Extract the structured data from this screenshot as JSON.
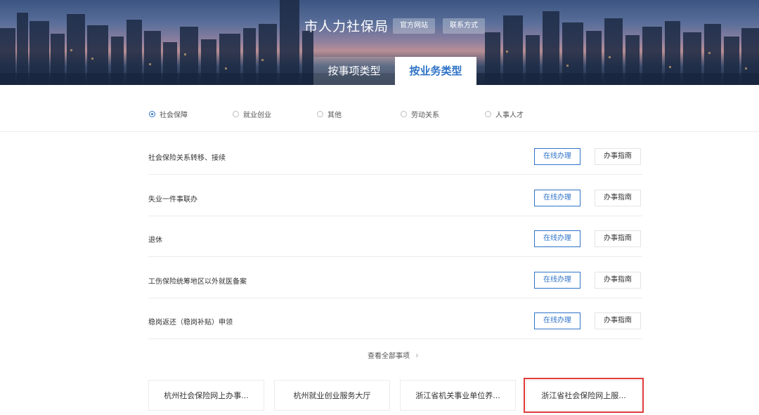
{
  "header": {
    "title": "市人力社保局",
    "links": {
      "official_site": "官方网站",
      "contact": "联系方式"
    },
    "tabs": [
      {
        "label": "按事项类型",
        "active": false
      },
      {
        "label": "按业务类型",
        "active": true
      }
    ]
  },
  "filters": {
    "options": [
      {
        "label": "社会保障",
        "checked": true
      },
      {
        "label": "就业创业",
        "checked": false
      },
      {
        "label": "其他",
        "checked": false
      },
      {
        "label": "劳动关系",
        "checked": false
      },
      {
        "label": "人事人才",
        "checked": false
      }
    ]
  },
  "services": {
    "online_label": "在线办理",
    "guide_label": "办事指南",
    "items": [
      {
        "name": "社会保险关系转移、接续"
      },
      {
        "name": "失业一件事联办"
      },
      {
        "name": "退休"
      },
      {
        "name": "工伤保险统筹地区以外就医备案"
      },
      {
        "name": "稳岗返还（稳岗补贴）申领"
      }
    ],
    "view_all": "查看全部事项"
  },
  "quick_links": [
    {
      "label": "杭州社会保险网上办事...",
      "highlighted": false
    },
    {
      "label": "杭州就业创业服务大厅",
      "highlighted": false
    },
    {
      "label": "浙江省机关事业单位养...",
      "highlighted": false
    },
    {
      "label": "浙江省社会保险网上服...",
      "highlighted": true
    }
  ],
  "colors": {
    "accent": "#2f73c8",
    "highlight_border": "#e23b3b"
  }
}
